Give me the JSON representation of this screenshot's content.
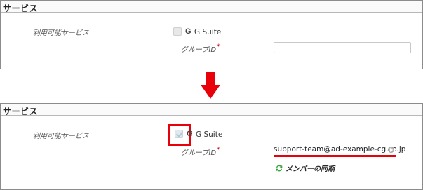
{
  "before": {
    "section_title": "サービス",
    "service_label": "利用可能サービス",
    "service_name": "G Suite",
    "service_checked": false,
    "group_label": "グループID",
    "required_mark": "*",
    "group_value": ""
  },
  "after": {
    "section_title": "サービス",
    "service_label": "利用可能サービス",
    "service_name": "G Suite",
    "service_checked": true,
    "group_label": "グループID",
    "required_mark": "*",
    "group_value": "support-team@ad-example-cg.co.jp",
    "sync_link": "メンバーの同期"
  },
  "icons": {
    "google": "G",
    "arrow": "down-arrow-icon",
    "edit": "edit-icon",
    "sync": "sync-icon"
  },
  "colors": {
    "highlight": "#e8000b",
    "arrow": "#e8000b",
    "required": "#d0021b",
    "sync_green": "#3aa53a"
  }
}
